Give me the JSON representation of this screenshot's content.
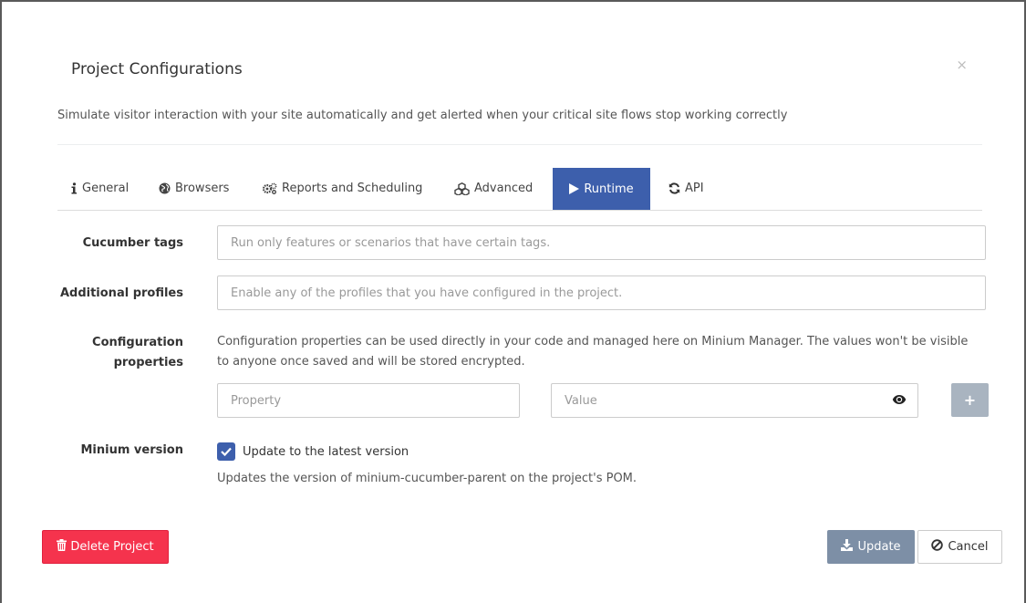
{
  "modal": {
    "title": "Project Configurations",
    "close_glyph": "×",
    "subtitle": "Simulate visitor interaction with your site automatically and get alerted when your critical site flows stop working correctly"
  },
  "tabs": [
    {
      "label": "General",
      "icon": "info-icon",
      "active": false
    },
    {
      "label": "Browsers",
      "icon": "globe-icon",
      "active": false
    },
    {
      "label": "Reports and Scheduling",
      "icon": "gears-icon",
      "active": false
    },
    {
      "label": "Advanced",
      "icon": "cubes-icon",
      "active": false
    },
    {
      "label": "Runtime",
      "icon": "play-icon",
      "active": true
    },
    {
      "label": "API",
      "icon": "refresh-icon",
      "active": false
    }
  ],
  "form": {
    "cucumber_tags": {
      "label": "Cucumber tags",
      "value": "",
      "placeholder": "Run only features or scenarios that have certain tags."
    },
    "additional_profiles": {
      "label": "Additional profiles",
      "value": "",
      "placeholder": "Enable any of the profiles that you have configured in the project."
    },
    "configuration_properties": {
      "label_line1": "Configuration",
      "label_line2": "properties",
      "help_text": "Configuration properties can be used directly in your code and managed here on Minium Manager. The values won't be visible to anyone once saved and will be stored encrypted.",
      "property_placeholder": "Property",
      "value_placeholder": "Value",
      "add_glyph": "+"
    },
    "minium_version": {
      "label": "Minium version",
      "checkbox_label": "Update to the latest version",
      "checked": true,
      "help_text": "Updates the version of minium-cucumber-parent on the project's POM."
    }
  },
  "footer": {
    "delete_label": "Delete Project",
    "update_label": "Update",
    "cancel_label": "Cancel"
  },
  "colors": {
    "primary": "#3d5fac",
    "danger": "#f5334d",
    "update_button": "#7d8fa6",
    "add_button": "#a9b4c0"
  }
}
